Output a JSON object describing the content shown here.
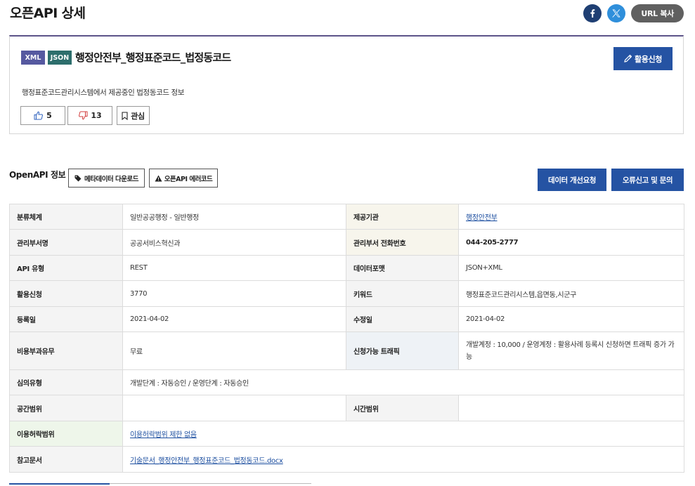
{
  "header": {
    "title": "오픈API 상세",
    "share": {
      "facebook_icon": "facebook-icon",
      "x_icon": "x-twitter-icon",
      "url_copy_label": "URL 복사"
    }
  },
  "summary": {
    "tags": [
      "XML",
      "JSON"
    ],
    "title": "행정안전부_행정표준코드_법정동코드",
    "apply_label": "활용신청",
    "description": "행정표준코드관리시스템에서 제공중인 법정동코드 정보",
    "likes": "5",
    "dislikes": "13",
    "interest_label": "관심"
  },
  "openapi": {
    "section_title": "OpenAPI 정보",
    "metadata_download_label": "메타데이터 다운로드",
    "error_code_label": "오픈API 에러코드",
    "improve_request_label": "데이터 개선요청",
    "report_label": "오류신고 및 문의"
  },
  "info_table": {
    "classification_label": "분류체계",
    "classification_value": "일반공공행정 - 일반행정",
    "provider_label": "제공기관",
    "provider_value": "행정안전부",
    "dept_label": "관리부서명",
    "dept_value": "공공서비스혁신과",
    "phone_label": "관리부서 전화번호",
    "phone_value": "044-205-2777",
    "api_type_label": "API 유형",
    "api_type_value": "REST",
    "format_label": "데이터포맷",
    "format_value": "JSON+XML",
    "apply_count_label": "활용신청",
    "apply_count_value": "3770",
    "keyword_label": "키워드",
    "keyword_value": "행정표준코드관리시스템,읍면동,시군구",
    "registered_label": "등록일",
    "registered_value": "2021-04-02",
    "modified_label": "수정일",
    "modified_value": "2021-04-02",
    "fee_label": "비용부과유무",
    "fee_value": "무료",
    "traffic_label": "신청가능 트래픽",
    "traffic_value": "개발계정 : 10,000 / 운영계정 : 활용사례 등록시 신청하면 트래픽 증가 가능",
    "review_label": "심의유형",
    "review_value": "개발단계 : 자동승인 / 운영단계 : 자동승인",
    "spatial_label": "공간범위",
    "spatial_value": "",
    "temporal_label": "시간범위",
    "temporal_value": "",
    "license_label": "이용허락범위",
    "license_value": "이용허락범위 제한 없음",
    "reference_label": "참고문서",
    "reference_value": "기술문서_행정안전부_행정표준코드_법정동코드.docx"
  },
  "colors": {
    "primary_button": "#2553a3",
    "summary_border_top": "#5c5489",
    "xml_tag": "#5659a0",
    "json_tag": "#2d6e6c",
    "facebook": "#1f3f73",
    "x_twitter": "#2f8fdb"
  }
}
